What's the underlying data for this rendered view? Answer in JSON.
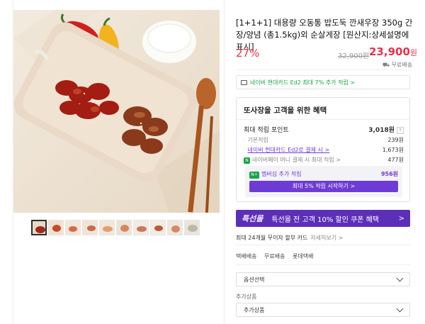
{
  "product": {
    "title": "[1+1+1] 대용량 오동통 밥도둑 깐새우장 350g 간장/양념 (총1.5kg)외 순살게장 [원산지:상세설명에 표시]",
    "discount": "27%",
    "original_price": "32,900원",
    "price": "23,900",
    "price_unit": "원",
    "shipping_badge": "무료배송"
  },
  "card_banner": {
    "text": "네이버 현대카드 Ed2 최대 7% 추가 적립 >"
  },
  "benefits": {
    "title": "또사장을 고객을 위한 혜택",
    "total_label": "최대 적립 포인트",
    "total_value": "3,018원",
    "help_icon": "?",
    "rows": [
      {
        "label": "기본적립",
        "value": "239원"
      },
      {
        "label": "네이버 현대카드 Ed2로 결제 시 >",
        "value": "1,673원"
      },
      {
        "label": "네이버페이 머니 결제 시 최대 적립 >",
        "value": "477원"
      }
    ],
    "membership_badge": "N+",
    "membership_label": "멤버십 추가 적립",
    "membership_value": "956원",
    "membership_button": "최대 5% 적립 시작하기 >"
  },
  "promo": {
    "logo": "특선몰",
    "text": "특선몰 전 고객 10% 할인 쿠폰 혜택",
    "arrow": ">"
  },
  "installment": {
    "text": "최대 24개월 무이자 할부 카드",
    "more": "자세히보기 >"
  },
  "shipping": {
    "label": "택배배송",
    "fee": "무료배송",
    "carrier": "롯데택배"
  },
  "options": {
    "select_placeholder": "옵션선택"
  },
  "addon": {
    "label": "추가상품",
    "select_placeholder": "추가상품"
  },
  "colors": {
    "accent_red": "#e6324b",
    "naver_green": "#1aa34a",
    "purple": "#6f3bd6",
    "promo_purple": "#5c2fb8"
  },
  "thumbnails": {
    "count": 10,
    "active_index": 0
  }
}
